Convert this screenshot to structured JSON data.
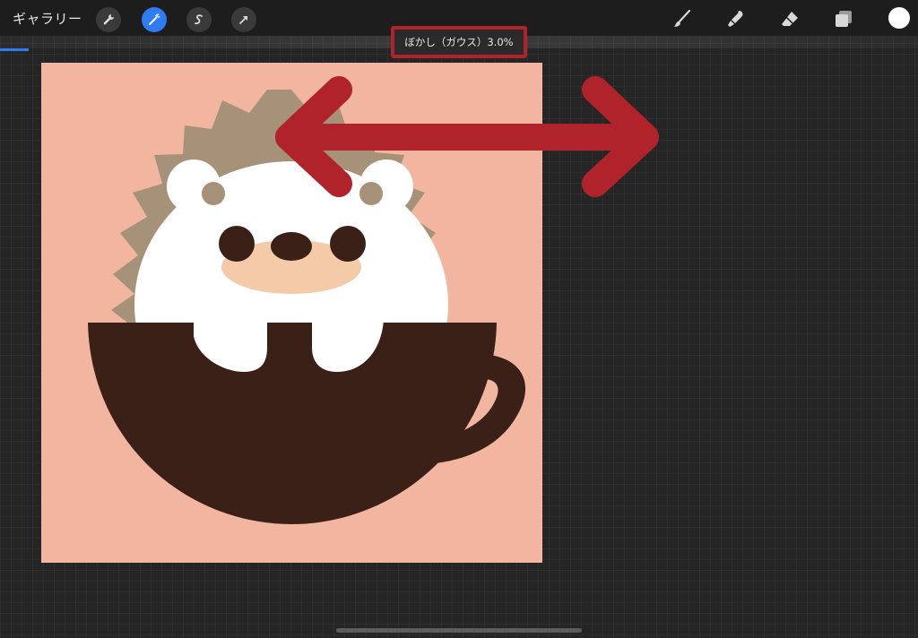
{
  "toolbar": {
    "gallery_label": "ギャラリー",
    "left_tools": [
      {
        "name": "actions",
        "icon": "wrench-icon"
      },
      {
        "name": "adjustments",
        "icon": "magic-wand-icon",
        "active": true
      },
      {
        "name": "selection",
        "icon": "selection-s-icon"
      },
      {
        "name": "transform",
        "icon": "arrow-icon"
      }
    ],
    "right_tools": [
      {
        "name": "brush",
        "icon": "brush-icon"
      },
      {
        "name": "smudge",
        "icon": "smudge-icon"
      },
      {
        "name": "eraser",
        "icon": "eraser-icon"
      },
      {
        "name": "layers",
        "icon": "layers-icon"
      },
      {
        "name": "color",
        "icon": "color-swatch",
        "value": "#ffffff"
      }
    ]
  },
  "adjustment": {
    "label": "ぼかし（ガウス）3.0%",
    "value_percent": 3.0
  },
  "colors": {
    "accent": "#2f7bf2",
    "highlight": "#b0232a",
    "canvas_bg": "#f2b5a0",
    "cup": "#3b2018",
    "bear": "#ffffff",
    "spikes": "#a69279",
    "snout": "#f5caa8"
  }
}
